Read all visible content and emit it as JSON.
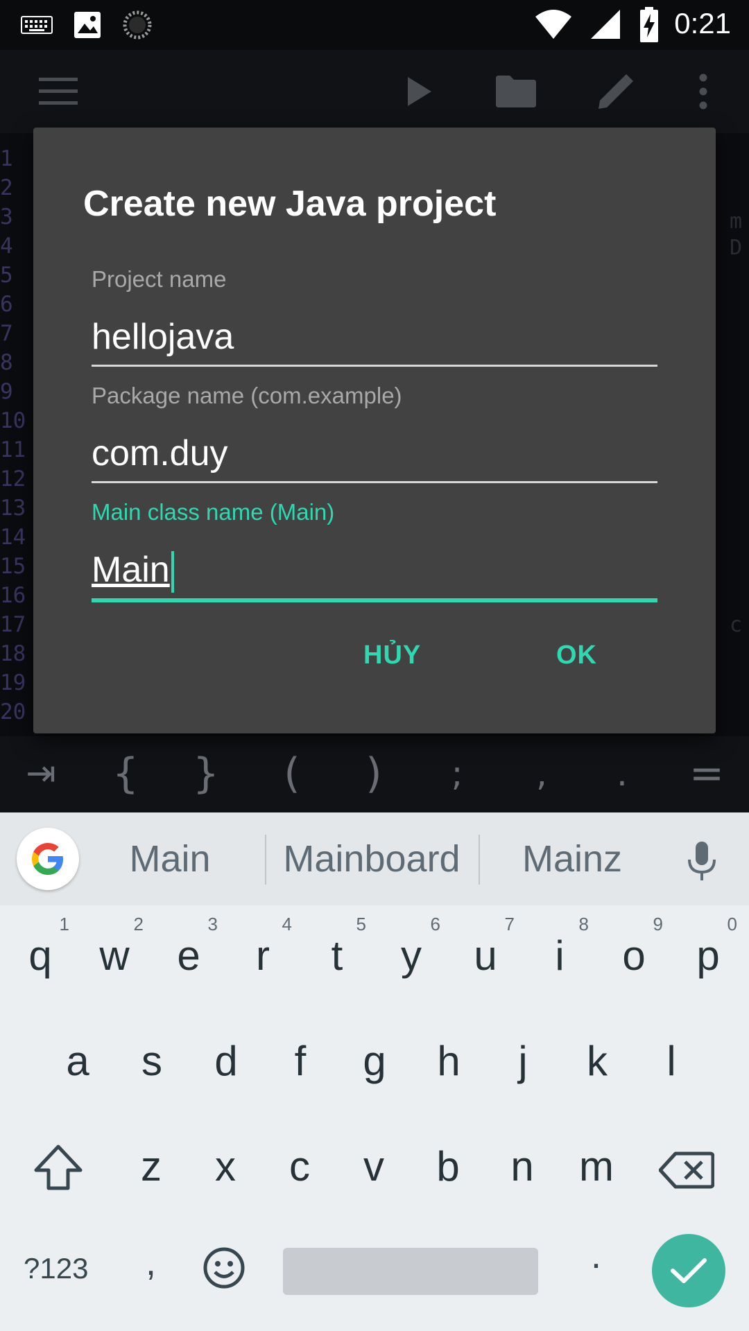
{
  "status_bar": {
    "time": "0:21",
    "icons": [
      "keyboard-icon",
      "image-icon",
      "sync-spinner-icon",
      "wifi-icon",
      "cell-signal-icon",
      "battery-charging-icon"
    ]
  },
  "toolbar": {
    "icons": [
      "menu-icon",
      "run-icon",
      "folder-icon",
      "edit-icon",
      "more-icon"
    ]
  },
  "editor": {
    "line_numbers": [
      "1",
      "2",
      "3",
      "4",
      "5",
      "6",
      "7",
      "8",
      "9",
      "10",
      "11",
      "12",
      "13",
      "14",
      "15",
      "16",
      "17",
      "18",
      "19",
      "20"
    ]
  },
  "symbol_bar": {
    "keys": [
      "⇥",
      "{",
      "}",
      "(",
      ")",
      ";",
      ",",
      ".",
      "="
    ]
  },
  "dialog": {
    "title": "Create new Java project",
    "fields": [
      {
        "label": "Project name",
        "value": "hellojava",
        "focused": false
      },
      {
        "label": "Package name (com.example)",
        "value": "com.duy",
        "focused": false
      },
      {
        "label": "Main class name (Main)",
        "value": "Main",
        "focused": true
      }
    ],
    "cancel_label": "HỦY",
    "ok_label": "OK"
  },
  "keyboard": {
    "suggestions": [
      "Main",
      "Mainboard",
      "Mainz"
    ],
    "row1": [
      {
        "key": "q",
        "hint": "1"
      },
      {
        "key": "w",
        "hint": "2"
      },
      {
        "key": "e",
        "hint": "3"
      },
      {
        "key": "r",
        "hint": "4"
      },
      {
        "key": "t",
        "hint": "5"
      },
      {
        "key": "y",
        "hint": "6"
      },
      {
        "key": "u",
        "hint": "7"
      },
      {
        "key": "i",
        "hint": "8"
      },
      {
        "key": "o",
        "hint": "9"
      },
      {
        "key": "p",
        "hint": "0"
      }
    ],
    "row2": [
      "a",
      "s",
      "d",
      "f",
      "g",
      "h",
      "j",
      "k",
      "l"
    ],
    "row3": [
      "z",
      "x",
      "c",
      "v",
      "b",
      "n",
      "m"
    ],
    "symbols_key": "?123",
    "comma_key": ",",
    "period_key": ".",
    "accent_color": "#2ed8b0",
    "enter_color": "#3fb6a0"
  }
}
